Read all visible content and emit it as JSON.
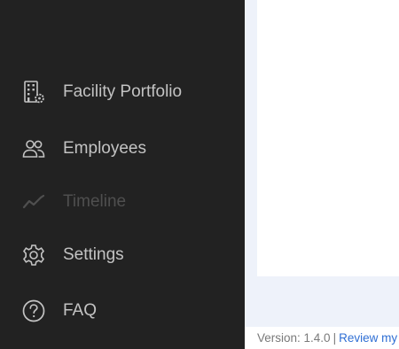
{
  "sidebar": {
    "items": [
      {
        "label": "Facility Portfolio",
        "icon": "building-gear-icon",
        "disabled": false
      },
      {
        "label": "Employees",
        "icon": "people-icon",
        "disabled": false
      },
      {
        "label": "Timeline",
        "icon": "trend-line-icon",
        "disabled": true
      },
      {
        "label": "Settings",
        "icon": "gear-icon",
        "disabled": false
      },
      {
        "label": "FAQ",
        "icon": "question-circle-icon",
        "disabled": false
      }
    ]
  },
  "footer": {
    "version": "Version: 1.4.0",
    "separator": "|",
    "link": "Review my"
  },
  "colors": {
    "sidebar_bg": "#222222",
    "nav_text": "#c3c3c3",
    "nav_disabled": "#4f4f4f",
    "page_bg": "#eef2fa",
    "link": "#2f6fd4"
  }
}
